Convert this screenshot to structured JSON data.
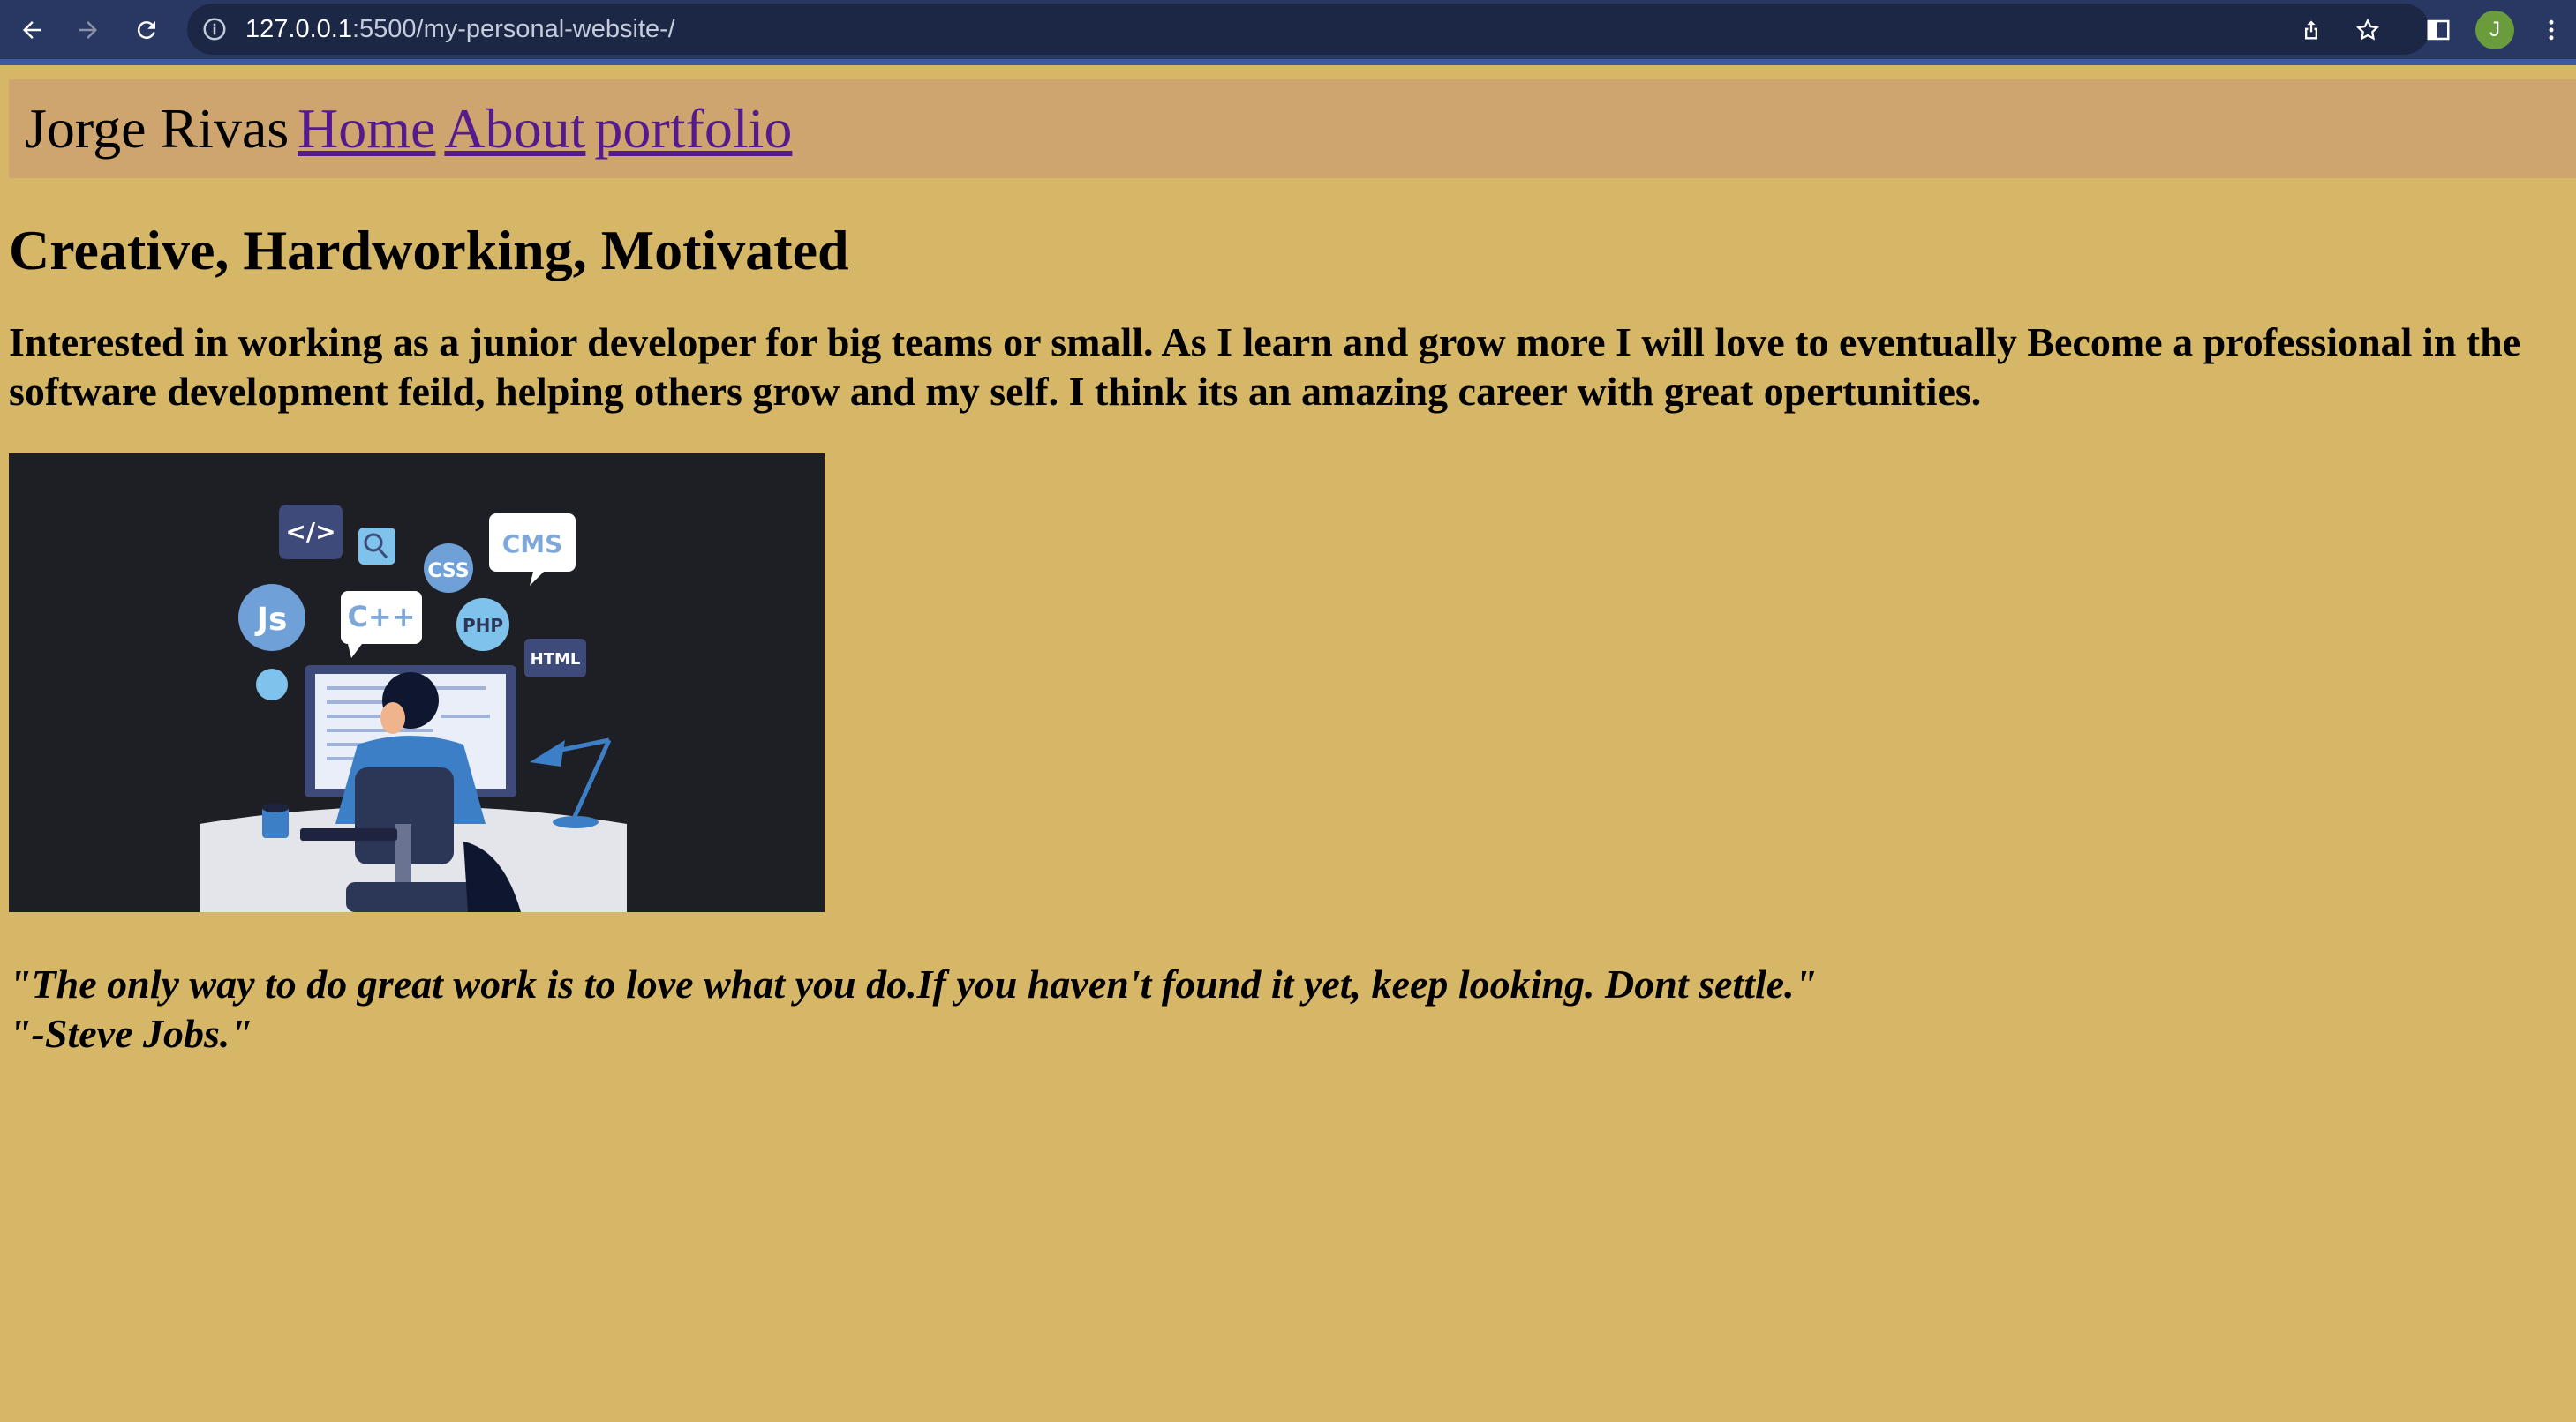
{
  "browser": {
    "url_host": "127.0.0.1",
    "url_rest": ":5500/my-personal-website-/",
    "profile_initial": "J",
    "icons": [
      "back-arrow-icon",
      "forward-arrow-icon",
      "reload-icon",
      "info-icon",
      "share-icon",
      "star-icon",
      "side-panel-icon",
      "menu-icon"
    ]
  },
  "nav": {
    "brand": "Jorge Rivas",
    "links": [
      "Home",
      "About",
      "portfolio"
    ]
  },
  "hero": {
    "headline": "Creative, Hardworking, Motivated",
    "intro": "Interested in working as a junior developer for big teams or small. As I learn and grow more I will love to eventually Become a professional in the software development feild, helping others grow and my self. I think its an amazing career with great opertunities."
  },
  "illustration": {
    "bubbles": [
      "</>",
      "CMS",
      "CSS",
      "Js",
      "C++",
      "PHP",
      "HTML"
    ]
  },
  "quote": {
    "line1": "\"The only way to do great work is to love what you do.If you haven't found it yet, keep looking. Dont settle.\"",
    "line2": "\"-Steve Jobs.\""
  },
  "colors": {
    "page_bg": "#d6b767",
    "navbar_bg": "#cea56e",
    "link": "#551a8b",
    "toolbar": "#283862"
  }
}
